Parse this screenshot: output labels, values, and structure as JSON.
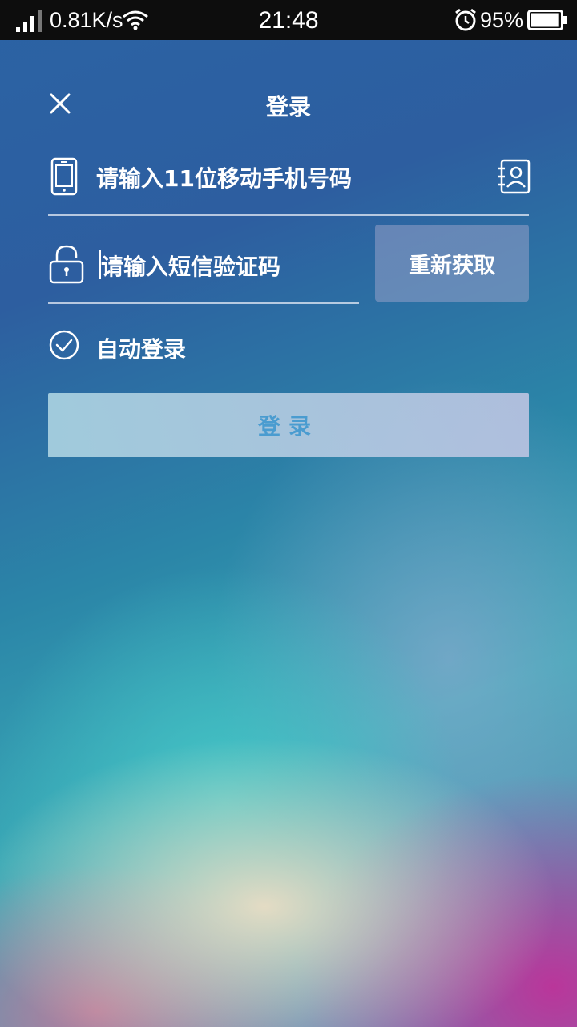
{
  "status_bar": {
    "network_speed": "0.81K/s",
    "time": "21:48",
    "battery_percent": "95%",
    "battery_level": 0.95,
    "icons": [
      "signal-icon",
      "wifi-icon",
      "alarm-icon",
      "battery-icon"
    ]
  },
  "header": {
    "title": "登录",
    "close_icon": "close-icon"
  },
  "phone_field": {
    "placeholder": "请输入11位移动手机号码",
    "value": "",
    "icon": "phone-icon",
    "action_icon": "contacts-icon"
  },
  "code_field": {
    "placeholder": "请输入短信验证码",
    "value": "",
    "icon": "lock-icon",
    "resend_label": "重新获取"
  },
  "auto_login": {
    "label": "自动登录",
    "checked": true
  },
  "login_button": {
    "label": "登录"
  },
  "colors": {
    "login_button_text": "#4a9cd0",
    "status_bar_bg": "#0d0d0d"
  }
}
